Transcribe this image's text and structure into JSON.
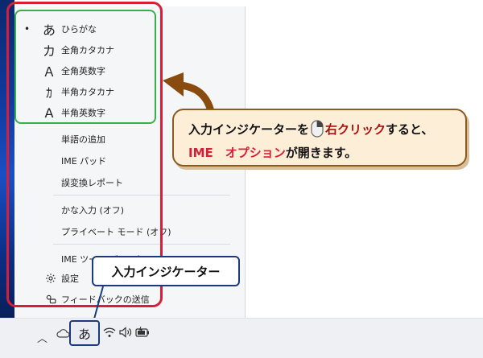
{
  "ime_menu": {
    "modes": [
      {
        "glyph": "あ",
        "label": "ひらがな",
        "selected": true
      },
      {
        "glyph": "カ",
        "label": "全角カタカナ",
        "selected": false
      },
      {
        "glyph": "Ａ",
        "label": "全角英数字",
        "selected": false
      },
      {
        "glyph": "ｶ",
        "label": "半角カタカナ",
        "selected": false
      },
      {
        "glyph": "A",
        "label": "半角英数字",
        "selected": false
      }
    ],
    "selected_bullet": "•",
    "actions": [
      {
        "label": "単語の追加"
      },
      {
        "label": "IME パッド"
      },
      {
        "label": "誤変換レポート"
      }
    ],
    "toggles": [
      {
        "label": "かな入力 (オフ)"
      },
      {
        "label": "プライベート モード (オフ)"
      }
    ],
    "toolbar_item": {
      "label": "IME ツール バー (オフ)"
    },
    "settings": {
      "icon": "gear-icon",
      "label": "設定"
    },
    "feedback": {
      "icon": "feedback-icon",
      "label": "フィードバックの送信"
    }
  },
  "callout": {
    "line1_prefix": "入力インジケーターを",
    "line1_highlight": "右クリック",
    "line1_suffix": "すると、",
    "line2_highlight": "IME　オプション",
    "line2_suffix": "が開きます。"
  },
  "indicator_label": "入力インジケーター",
  "taskbar": {
    "ime_indicator": "あ",
    "icons": [
      "chevron-up-icon",
      "cloud-icon",
      "wifi-icon",
      "speaker-icon",
      "battery-icon"
    ]
  },
  "colors": {
    "green_outline": "#35b04a",
    "red_outline": "#d81e36",
    "navy_outline": "#1b3a7a",
    "callout_fill": "#fdeed8",
    "callout_border": "#8a5a1e",
    "arrow": "#8a4b0f"
  }
}
